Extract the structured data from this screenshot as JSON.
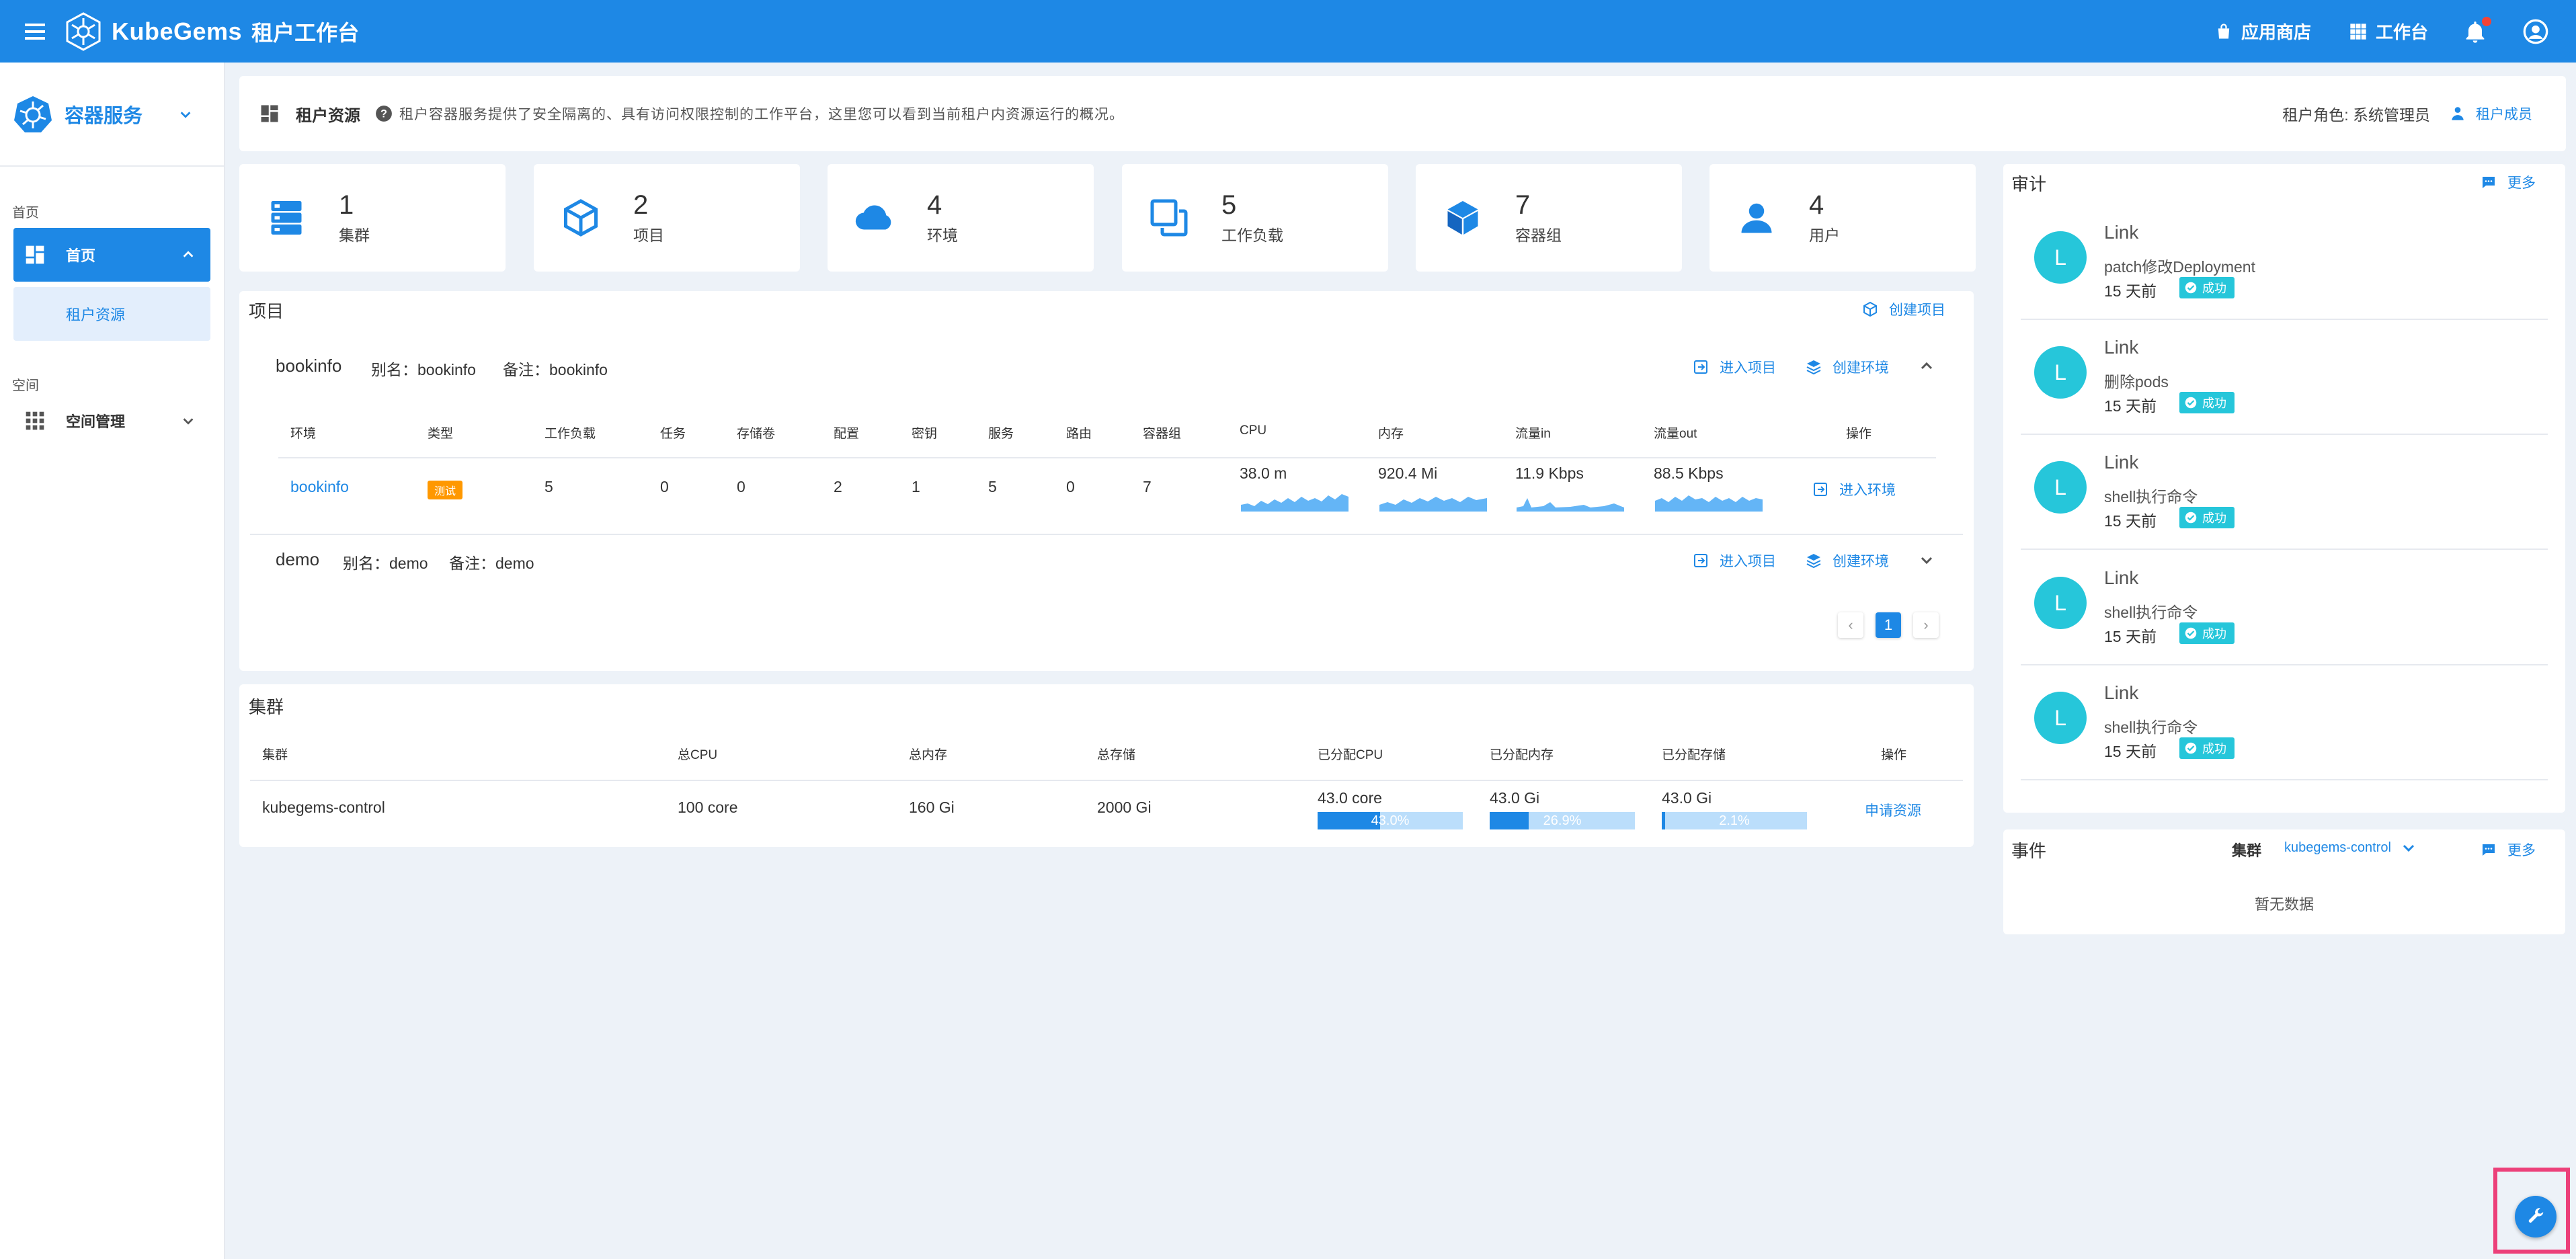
{
  "topbar": {
    "brand": "KubeGems",
    "subtitle": "租户工作台",
    "app_store": "应用商店",
    "workbench": "工作台",
    "accent": "#1e88e5"
  },
  "sidebar": {
    "service": "容器服务",
    "section_home": "首页",
    "home": "首页",
    "tenant_resources": "租户资源",
    "section_space": "空间",
    "space_mgmt": "空间管理"
  },
  "header": {
    "title": "租户资源",
    "description": "租户容器服务提供了安全隔离的、具有访问权限控制的工作平台，这里您可以看到当前租户内资源运行的概况。",
    "role": "租户角色: 系统管理员",
    "members": "租户成员"
  },
  "stats": [
    {
      "num": "1",
      "label": "集群",
      "icon": "server-icon"
    },
    {
      "num": "2",
      "label": "项目",
      "icon": "cube-outline-icon"
    },
    {
      "num": "4",
      "label": "环境",
      "icon": "cloud-icon"
    },
    {
      "num": "5",
      "label": "工作负载",
      "icon": "copy-icon"
    },
    {
      "num": "7",
      "label": "容器组",
      "icon": "cube-solid-icon"
    },
    {
      "num": "4",
      "label": "用户",
      "icon": "user-icon"
    }
  ],
  "projects": {
    "title": "项目",
    "create_project": "创建项目",
    "enter_project": "进入项目",
    "create_env": "创建环境",
    "items": [
      {
        "name": "bookinfo",
        "alias": "别名：bookinfo",
        "remark": "备注：bookinfo"
      },
      {
        "name": "demo",
        "alias": "别名：demo",
        "remark": "备注：demo"
      }
    ],
    "columns": [
      "环境",
      "类型",
      "工作负载",
      "任务",
      "存储卷",
      "配置",
      "密钥",
      "服务",
      "路由",
      "容器组",
      "CPU",
      "内存",
      "流量in",
      "流量out",
      "操作"
    ],
    "env_row": {
      "env": "bookinfo",
      "type": "测试",
      "workloads": "5",
      "jobs": "0",
      "volumes": "0",
      "configs": "2",
      "secrets": "1",
      "services": "5",
      "routes": "0",
      "pods": "7",
      "cpu": "38.0 m",
      "memory": "920.4 Mi",
      "traffic_in": "11.9 Kbps",
      "traffic_out": "88.5 Kbps",
      "action": "进入环境"
    },
    "page": "1"
  },
  "cluster": {
    "title": "集群",
    "columns": [
      "集群",
      "总CPU",
      "总内存",
      "总存储",
      "已分配CPU",
      "已分配内存",
      "已分配存储",
      "操作"
    ],
    "row": {
      "name": "kubegems-control",
      "cpu": "100 core",
      "memory": "160 Gi",
      "storage": "2000 Gi",
      "alloc_cpu": "43.0 core",
      "alloc_cpu_pct": "43.0%",
      "alloc_cpu_frac": 0.43,
      "alloc_mem": "43.0 Gi",
      "alloc_mem_pct": "26.9%",
      "alloc_mem_frac": 0.269,
      "alloc_storage": "43.0 Gi",
      "alloc_storage_pct": "2.1%",
      "alloc_storage_frac": 0.021,
      "action": "申请资源"
    }
  },
  "audit": {
    "title": "审计",
    "more": "更多",
    "items": [
      {
        "avatar": "L",
        "user": "Link",
        "action": "patch修改Deployment",
        "time": "15 天前",
        "status": "成功"
      },
      {
        "avatar": "L",
        "user": "Link",
        "action": "删除pods",
        "time": "15 天前",
        "status": "成功"
      },
      {
        "avatar": "L",
        "user": "Link",
        "action": "shell执行命令",
        "time": "15 天前",
        "status": "成功"
      },
      {
        "avatar": "L",
        "user": "Link",
        "action": "shell执行命令",
        "time": "15 天前",
        "status": "成功"
      },
      {
        "avatar": "L",
        "user": "Link",
        "action": "shell执行命令",
        "time": "15 天前",
        "status": "成功"
      }
    ]
  },
  "events": {
    "title": "事件",
    "cluster_label": "集群",
    "cluster_value": "kubegems-control",
    "more": "更多",
    "empty": "暂无数据"
  }
}
